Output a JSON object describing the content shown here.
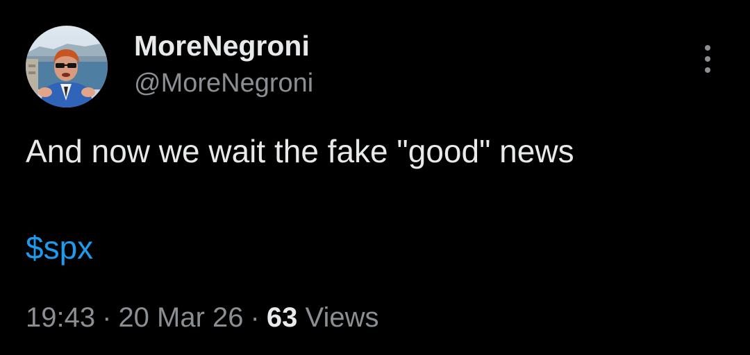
{
  "author": {
    "display_name": "MoreNegroni",
    "handle": "@MoreNegroni",
    "avatar_icon": "profile-photo"
  },
  "tweet": {
    "text": "And now we wait the fake \"good\" news",
    "cashtag": "$spx"
  },
  "meta": {
    "time": "19:43",
    "separator": "·",
    "date": "20 Mar 26",
    "views_count": "63",
    "views_label": "Views"
  },
  "menu": {
    "icon": "more-options-icon"
  },
  "colors": {
    "background": "#000000",
    "primary_text": "#e7e9ea",
    "secondary_text": "#8b8f94",
    "link": "#1d9bf0"
  }
}
